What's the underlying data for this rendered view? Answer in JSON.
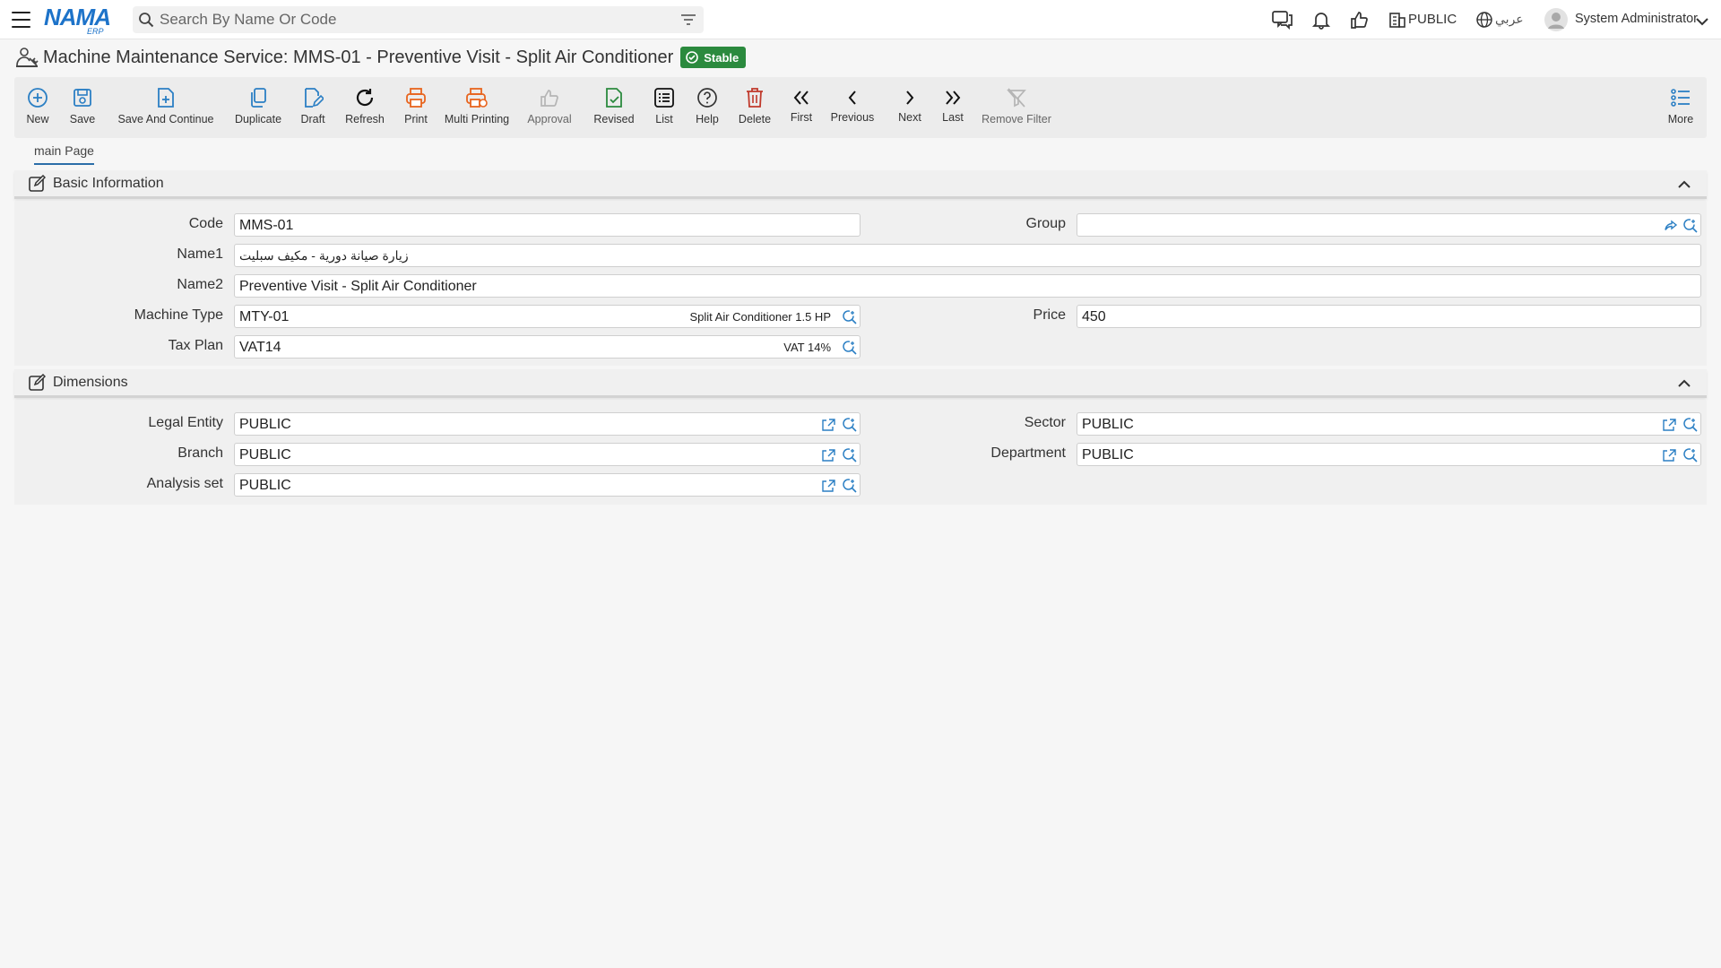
{
  "topbar": {
    "logo_text": "NAMA",
    "logo_sub": "ERP",
    "search_placeholder": "Search By Name Or Code",
    "company": "PUBLIC",
    "language": "عربي",
    "user_name": "System Administrator"
  },
  "page": {
    "title": "Machine Maintenance Service: MMS-01 - Preventive Visit - Split Air Conditioner",
    "status": "Stable"
  },
  "toolbar": {
    "new": "New",
    "save": "Save",
    "save_continue": "Save And Continue",
    "duplicate": "Duplicate",
    "draft": "Draft",
    "refresh": "Refresh",
    "print": "Print",
    "multi_printing": "Multi Printing",
    "approval": "Approval",
    "revised": "Revised",
    "list": "List",
    "help": "Help",
    "delete": "Delete",
    "first": "First",
    "previous": "Previous",
    "next": "Next",
    "last": "Last",
    "remove_filter": "Remove Filter",
    "more": "More"
  },
  "tabs": {
    "main": "main Page"
  },
  "basic": {
    "title": "Basic Information",
    "code_label": "Code",
    "code": "MMS-01",
    "group_label": "Group",
    "group": "",
    "name1_label": "Name1",
    "name1": "زيارة صيانة دورية - مكيف سبليت",
    "name2_label": "Name2",
    "name2": "Preventive Visit - Split Air Conditioner",
    "machine_type_label": "Machine Type",
    "machine_type": "MTY-01",
    "machine_type_desc": "Split Air Conditioner 1.5 HP",
    "price_label": "Price",
    "price": "450",
    "tax_plan_label": "Tax Plan",
    "tax_plan": "VAT14",
    "tax_plan_desc": "VAT 14%"
  },
  "dimensions": {
    "title": "Dimensions",
    "legal_entity_label": "Legal Entity",
    "legal_entity": "PUBLIC",
    "sector_label": "Sector",
    "sector": "PUBLIC",
    "branch_label": "Branch",
    "branch": "PUBLIC",
    "department_label": "Department",
    "department": "PUBLIC",
    "analysis_set_label": "Analysis set",
    "analysis_set": "PUBLIC"
  },
  "colors": {
    "accent_blue": "#2b7fc4",
    "orange": "#e8641e",
    "green": "#2b8a3e",
    "red": "#c0392b"
  }
}
